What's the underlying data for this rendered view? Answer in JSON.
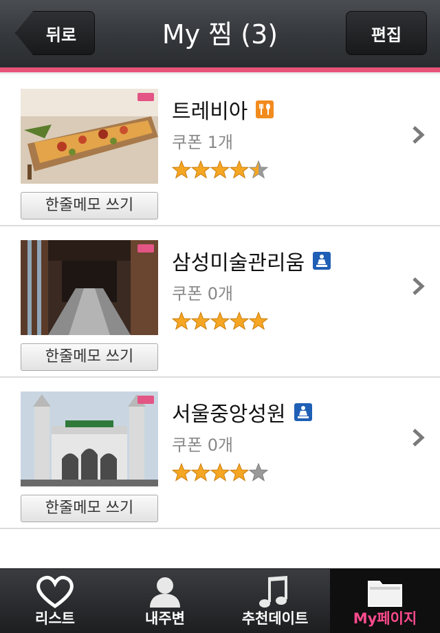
{
  "header": {
    "back_label": "뒤로",
    "title": "My 찜 (3)",
    "edit_label": "편집",
    "accent_color": "#e8537a"
  },
  "items": [
    {
      "name": "트레비아",
      "category_icon": "restaurant-icon",
      "coupon": "쿠폰 1개",
      "rating": 4.5,
      "memo_label": "한줄메모 쓰기"
    },
    {
      "name": "삼성미술관리움",
      "category_icon": "attraction-icon",
      "coupon": "쿠폰 0개",
      "rating": 5,
      "memo_label": "한줄메모 쓰기"
    },
    {
      "name": "서울중앙성원",
      "category_icon": "attraction-icon",
      "coupon": "쿠폰 0개",
      "rating": 4,
      "memo_label": "한줄메모 쓰기"
    }
  ],
  "tabs": [
    {
      "label": "리스트",
      "icon": "heart-icon",
      "active": false
    },
    {
      "label": "내주변",
      "icon": "person-icon",
      "active": false
    },
    {
      "label": "추천데이트",
      "icon": "music-note-icon",
      "active": false
    },
    {
      "label": "My페이지",
      "icon": "folder-icon",
      "active": true
    }
  ]
}
